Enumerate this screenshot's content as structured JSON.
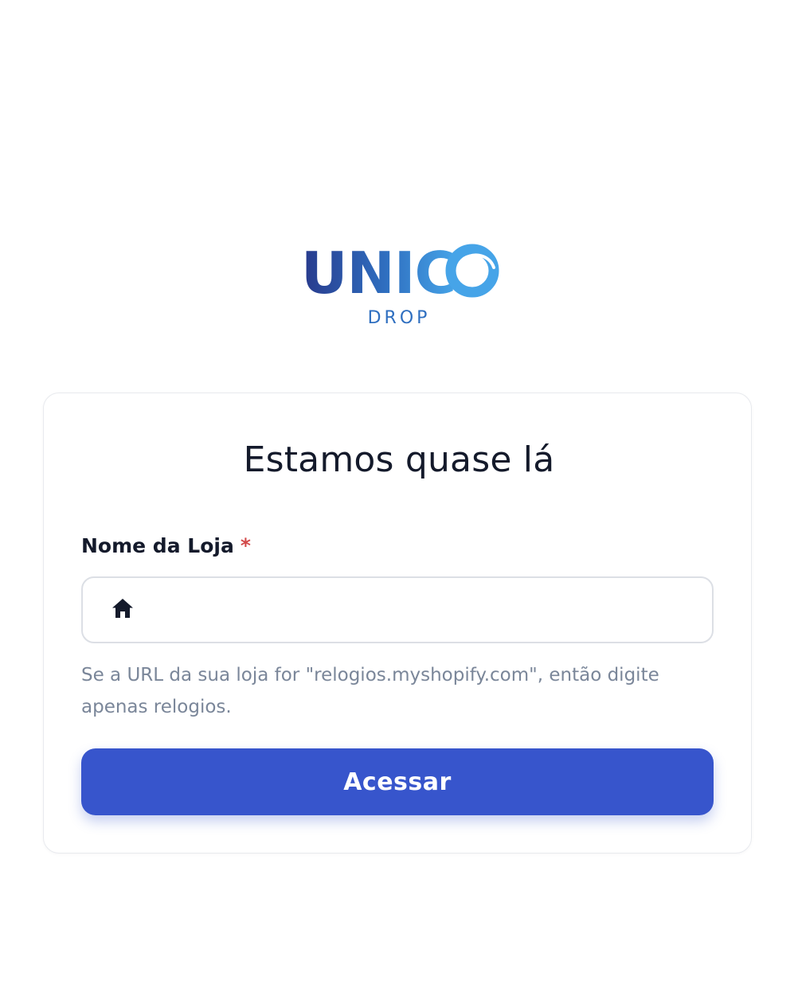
{
  "logo": {
    "primary_text": "UNIC",
    "secondary_text": "DROP",
    "colors": {
      "dark_blue": "#283a8c",
      "light_blue": "#46a4e8"
    }
  },
  "card": {
    "title": "Estamos quase lá",
    "store_field": {
      "label": "Nome da Loja",
      "required_mark": "*",
      "value": "",
      "icon": "home-icon"
    },
    "help_text": "Se a URL da sua loja for \"relogios.myshopify.com\", então digite apenas relogios.",
    "submit_label": "Acessar"
  },
  "colors": {
    "primary_button": "#3755cc",
    "required": "#d24949",
    "title_text": "#141a2b",
    "help_text": "#7a8699",
    "border": "#dcdfe5"
  }
}
